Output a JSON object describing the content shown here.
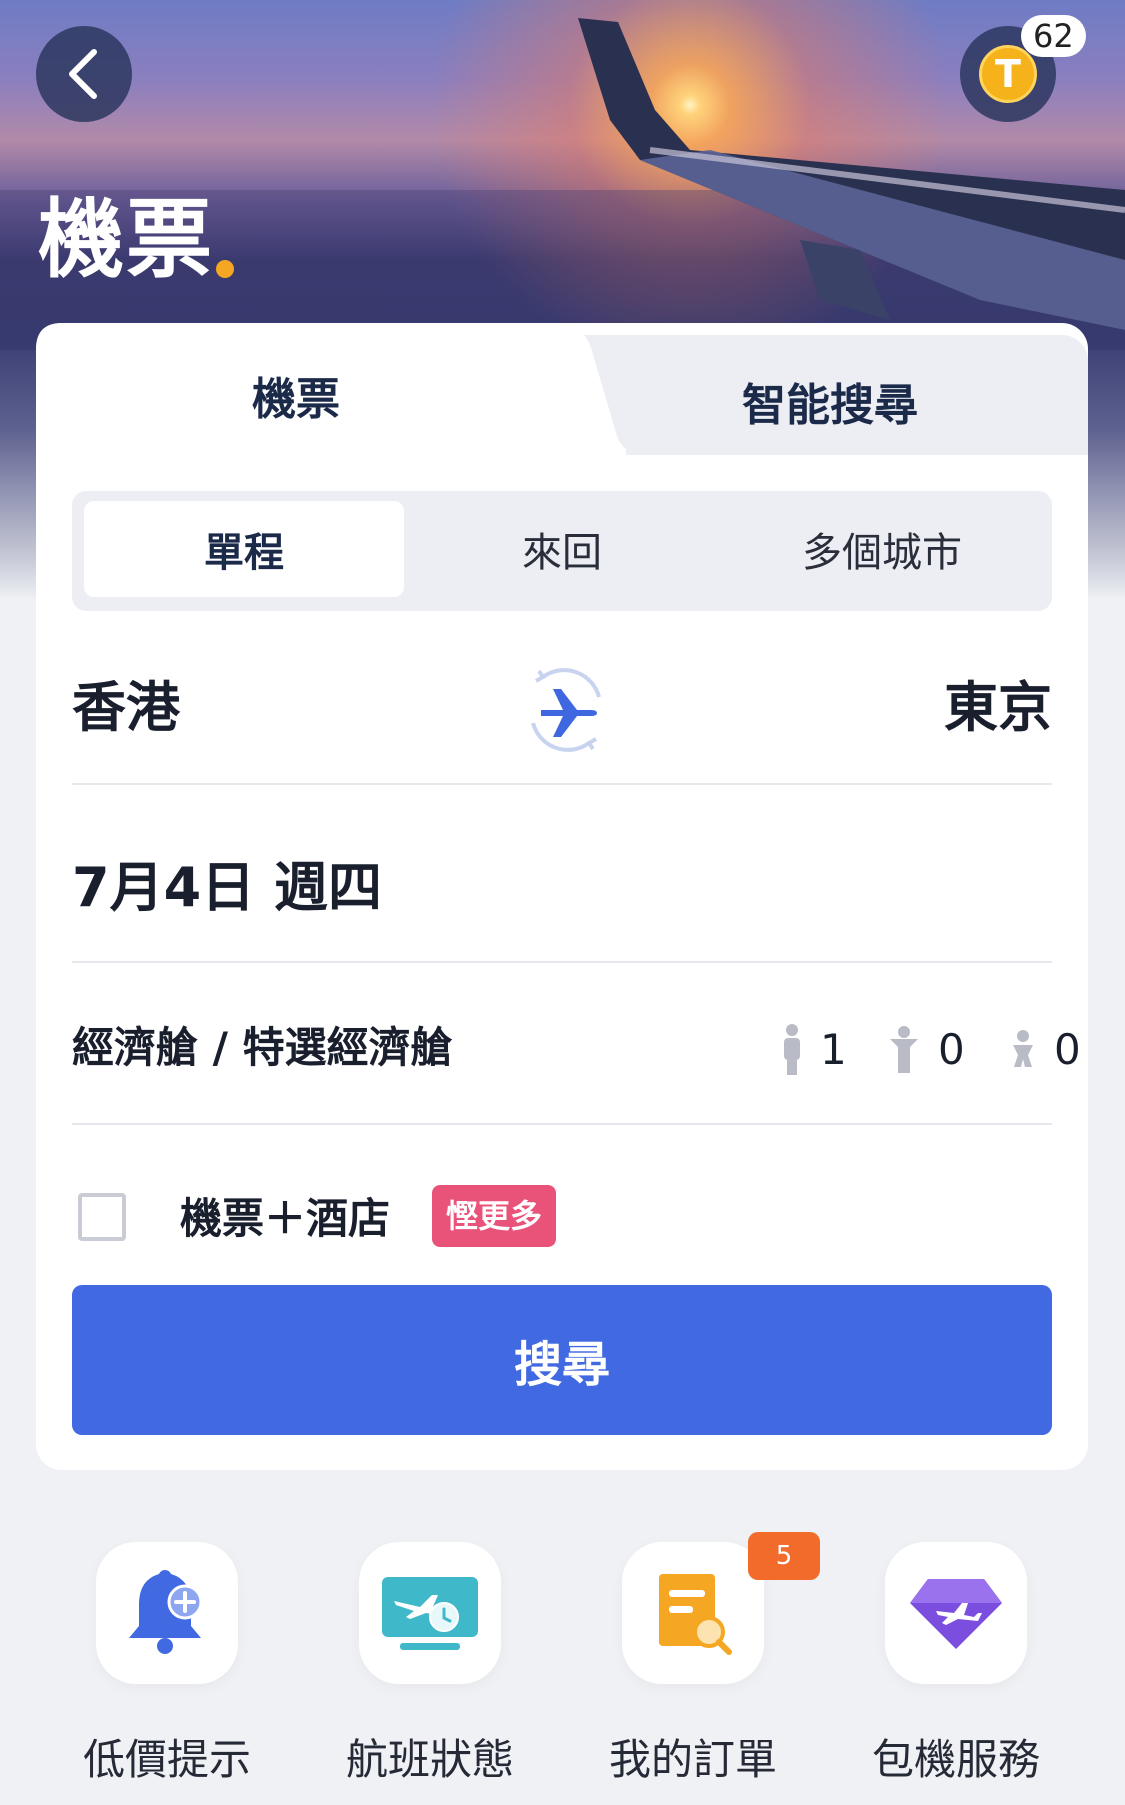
{
  "header": {
    "title": "機票",
    "coin_letter": "T",
    "coin_count": "62",
    "accent_dot_color": "#f5a623"
  },
  "card": {
    "tabs": [
      {
        "label": "機票",
        "active": true
      },
      {
        "label": "智能搜尋",
        "active": false
      }
    ],
    "trip_types": [
      {
        "label": "單程",
        "active": true
      },
      {
        "label": "來回",
        "active": false
      },
      {
        "label": "多個城市",
        "active": false
      }
    ],
    "origin": "香港",
    "destination": "東京",
    "date": "7月4日 週四",
    "cabin": "經濟艙 / 特選經濟艙",
    "passengers": {
      "adults": "1",
      "children": "0",
      "infants": "0"
    },
    "combo": {
      "label": "機票＋酒店",
      "checked": false,
      "badge": "慳更多",
      "badge_color": "#e9537a"
    },
    "search_button": "搜尋",
    "primary_color": "#4169e1"
  },
  "quick_actions": [
    {
      "label": "低價提示",
      "icon": "bell-plus-icon"
    },
    {
      "label": "航班狀態",
      "icon": "flight-status-icon"
    },
    {
      "label": "我的訂單",
      "icon": "order-search-icon",
      "badge": "5"
    },
    {
      "label": "包機服務",
      "icon": "charter-diamond-icon"
    }
  ]
}
